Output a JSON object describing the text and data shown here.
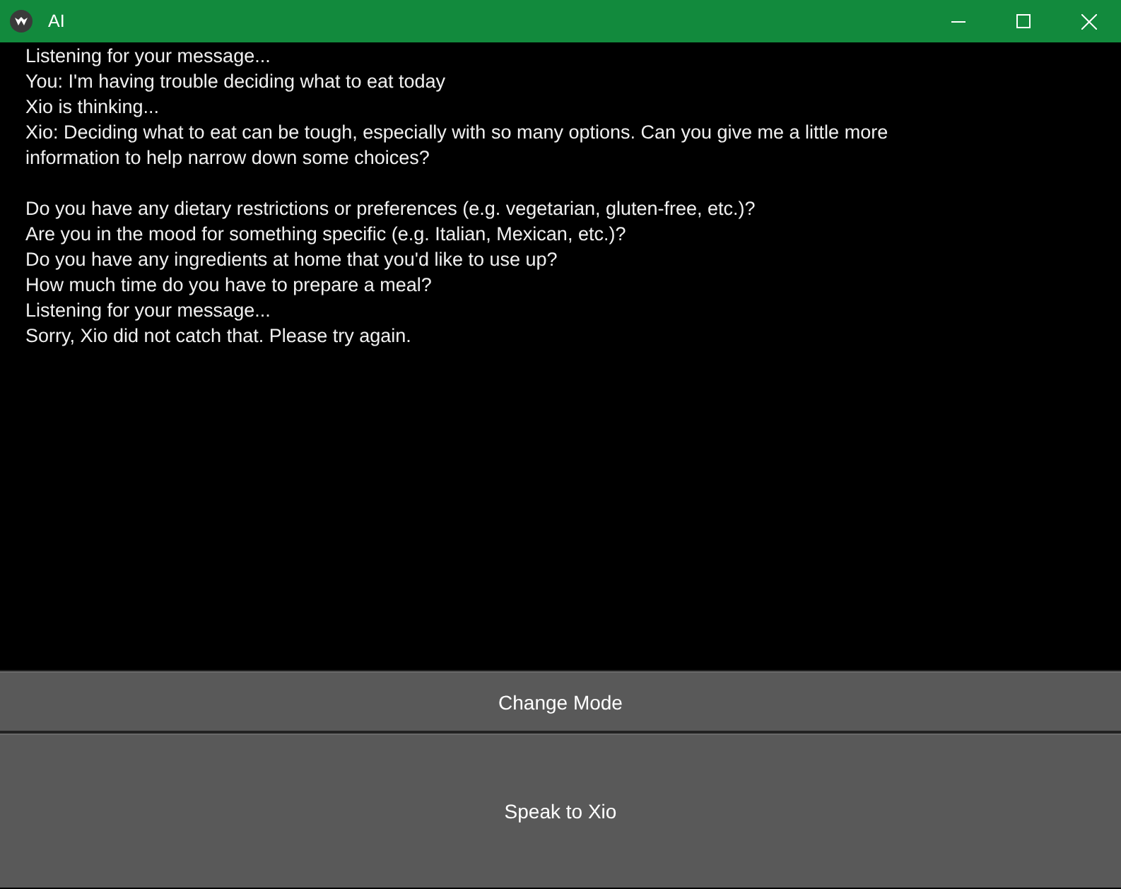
{
  "window": {
    "title": "AI"
  },
  "log": [
    {
      "kind": "line",
      "text": "Listening for your message..."
    },
    {
      "kind": "line",
      "text": "You: I'm having trouble deciding what to eat today"
    },
    {
      "kind": "line",
      "text": "Xio is thinking..."
    },
    {
      "kind": "line",
      "text": "Xio: Deciding what to eat can be tough, especially with so many options. Can you give me a little more"
    },
    {
      "kind": "line",
      "text": "information to help narrow down some choices?"
    },
    {
      "kind": "blank"
    },
    {
      "kind": "line",
      "text": "Do you have any dietary restrictions or preferences (e.g. vegetarian, gluten-free, etc.)?"
    },
    {
      "kind": "line",
      "text": "Are you in the mood for something specific (e.g. Italian, Mexican, etc.)?"
    },
    {
      "kind": "line",
      "text": "Do you have any ingredients at home that you'd like to use up?"
    },
    {
      "kind": "line",
      "text": "How much time do you have to prepare a meal?"
    },
    {
      "kind": "line",
      "text": "Listening for your message..."
    },
    {
      "kind": "line",
      "text": "Sorry, Xio did not catch that. Please try again."
    }
  ],
  "buttons": [
    {
      "label": "Change Mode",
      "kind": "bar"
    },
    {
      "label": "Speak to Xio",
      "kind": "panel"
    }
  ]
}
